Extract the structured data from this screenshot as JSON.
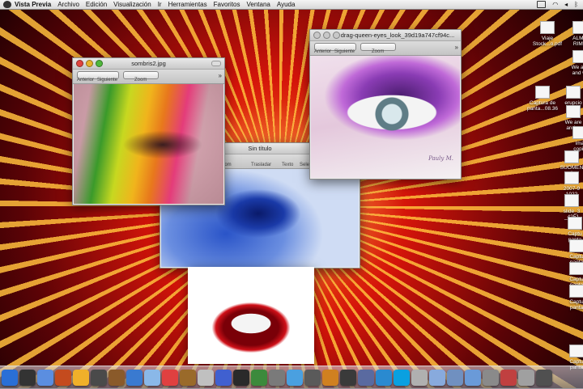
{
  "menubar": {
    "app_name": "Vista Previa",
    "items": [
      "Archivo",
      "Edición",
      "Visualización",
      "Ir",
      "Herramientas",
      "Favoritos",
      "Ventana",
      "Ayuda"
    ]
  },
  "window_sombras": {
    "title": "sombris2.jpg",
    "toolbar": {
      "back_label": "Anterior",
      "next_label": "Siguiente",
      "zoom_label": "Zoom"
    }
  },
  "window_drag": {
    "title": "drag-queen-eyes_look_39d19a747cf94c...",
    "toolbar": {
      "back_label": "Anterior",
      "next_label": "Siguiente",
      "zoom_label": "Zoom"
    }
  },
  "window_untitled": {
    "title": "Sin título",
    "toolbar": {
      "zoom_label": "oom",
      "move_label": "Trasladar",
      "text_label": "Texto",
      "select_label": "Selec"
    }
  },
  "desktop_icons": [
    {
      "label1": "Viaje",
      "label2": "Stock...o.pdf"
    },
    {
      "label1": "ALMA",
      "label2": "RIME"
    },
    {
      "label1": "We are",
      "label2": "and wi"
    },
    {
      "label1": "Captura de",
      "label2": "panta...08.36"
    },
    {
      "label1": "erupcio",
      "label2": "volca"
    },
    {
      "label1": "We are",
      "label2": "and w"
    },
    {
      "label1": "ima",
      "label2": "copia"
    },
    {
      "label1": "SUOMEN",
      "label2": "A"
    },
    {
      "label1": "2007-9",
      "label2": "1022"
    },
    {
      "label1": "slide_3",
      "label2": "_4251"
    },
    {
      "label1": "Captu",
      "label2": "panta"
    },
    {
      "label1": "Captu",
      "label2": "panta"
    },
    {
      "label1": "Captu",
      "label2": "panta"
    },
    {
      "label1": "Captu",
      "label2": "panta"
    },
    {
      "label1": "Captu",
      "label2": "panta"
    }
  ],
  "watermark": "Pauly M.",
  "dock": {
    "icon_colors": [
      "#2a6fd6",
      "#333333",
      "#5b8ee0",
      "#c44b1e",
      "#f0b02a",
      "#4a4a4a",
      "#8a5a2a",
      "#3a7ad0",
      "#8ab8e8",
      "#e04040",
      "#9a6a2a",
      "#c0c0c0",
      "#4060d0",
      "#2a2a2a",
      "#3c8a3c",
      "#7a7a7a",
      "#4aa0e0",
      "#5a5a5a",
      "#d08020",
      "#3a3a3a",
      "#5a6aa0",
      "#2a8ad0",
      "#0aa0e0",
      "#b0b0b0",
      "#88aadd",
      "#7090c0",
      "#6a9ad8",
      "#8a8a8a",
      "#c04040",
      "#a0a0a0",
      "#505050"
    ]
  }
}
